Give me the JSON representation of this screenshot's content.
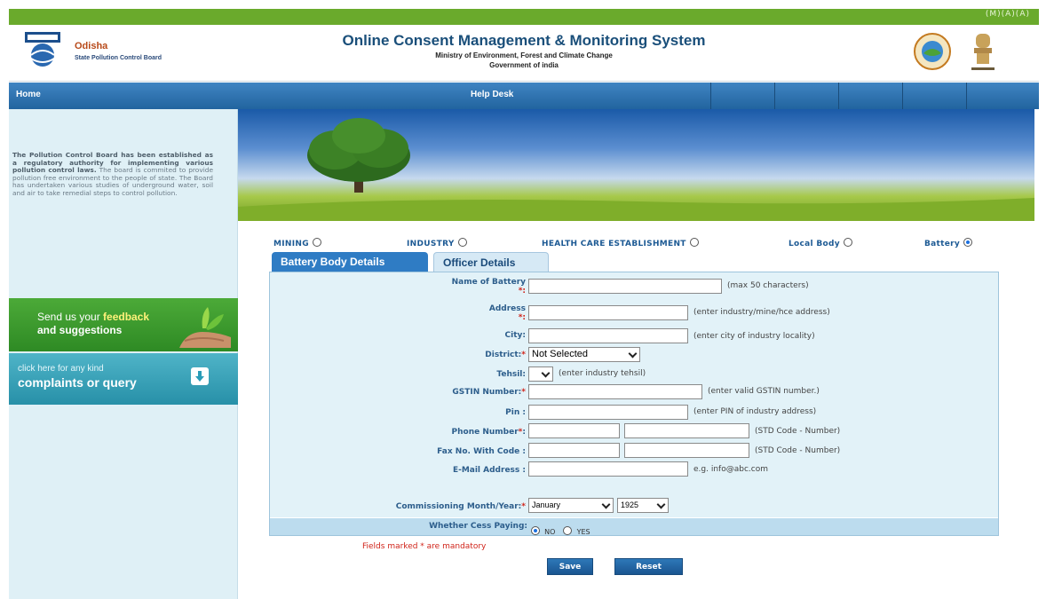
{
  "header": {
    "font_size_controls": "(M)(A)(A)",
    "brand_name": "Odisha",
    "brand_subtitle": "State Pollution Control Board",
    "system_title": "Online Consent Management & Monitoring System",
    "ministry": "Ministry of Environment, Forest and Climate Change",
    "government": "Government of india"
  },
  "nav": {
    "home": "Home",
    "help_desk": "Help Desk"
  },
  "sidebar": {
    "about_lead": "The Pollution Control Board has been established as a regulatory authority for implementing various pollution control laws.",
    "about_rest": " The board is commited to provide pollution free environment to the people of state. The Board has undertaken various studies of underground water, soil and air to take remedial steps to control pollution.",
    "feedback_prefix": "Send us your ",
    "feedback_bold": "feedback",
    "feedback_line2": "and suggestions",
    "complaints_small": "click here for any kind",
    "complaints_big": "complaints or query"
  },
  "categories": [
    {
      "label": "MINING",
      "selected": false
    },
    {
      "label": "INDUSTRY",
      "selected": false
    },
    {
      "label": "HEALTH CARE ESTABLISHMENT",
      "selected": false
    },
    {
      "label": "Local Body",
      "selected": false
    },
    {
      "label": "Battery",
      "selected": true
    }
  ],
  "tabs": {
    "active": "Battery Body Details",
    "inactive": "Officer Details"
  },
  "form": {
    "name_label": "Name of Battery",
    "name_hint": "(max 50 characters)",
    "address_label": "Address",
    "address_hint": "(enter industry/mine/hce address)",
    "city_label": "City:",
    "city_hint": "(enter city of industry locality)",
    "district_label": "District:",
    "district_value": "Not Selected",
    "tehsil_label": "Tehsil:",
    "tehsil_hint": "(enter industry tehsil)",
    "gstin_label": "GSTIN Number:",
    "gstin_hint": "(enter valid GSTIN number.)",
    "pin_label": "Pin :",
    "pin_hint": "(enter PIN of industry address)",
    "phone_label": "Phone Number",
    "phone_hint": "(STD Code - Number)",
    "fax_label": "Fax No. With Code :",
    "fax_hint": "(STD Code - Number)",
    "email_label": "E-Mail Address :",
    "email_hint": "e.g. info@abc.com",
    "commission_label": "Commissioning Month/Year:",
    "month_value": "January",
    "year_value": "1925",
    "cess_label": "Whether Cess Paying:",
    "cess_no": "NO",
    "cess_yes": "YES",
    "cess_selected": "NO"
  },
  "mandatory_note": "Fields marked * are mandatory",
  "buttons": {
    "save": "Save",
    "reset": "Reset"
  }
}
